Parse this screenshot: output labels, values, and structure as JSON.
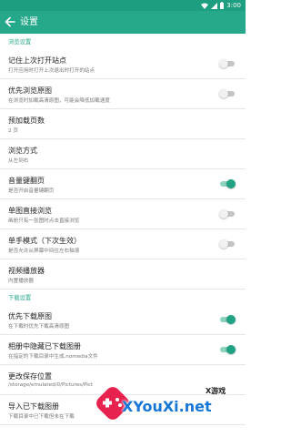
{
  "status_bar": {
    "time": "3:00",
    "icons": [
      "wifi-icon",
      "cellular-icon",
      "battery-icon"
    ]
  },
  "app_bar": {
    "title": "设置",
    "back_icon": "arrow-left-icon"
  },
  "theme": {
    "accent": "#26a88a",
    "status_bar": "#1e9e80",
    "switch_on": "#1fa383",
    "switch_off": "#c4c4c4"
  },
  "sections": [
    {
      "header": "浏览设置",
      "prefs": [
        {
          "title": "记住上次打开站点",
          "summary": "打开应用时打开上次退出时打开的站点",
          "toggle": false
        },
        {
          "title": "优先浏览原图",
          "summary": "在浏览时加载高清原图，可能会降低加载速度",
          "toggle": false
        },
        {
          "title": "预加载页数",
          "summary": "2 页",
          "toggle": null
        },
        {
          "title": "浏览方式",
          "summary": "从左到右",
          "toggle": null
        },
        {
          "title": "音量键翻页",
          "summary": "是否开启音量键翻页",
          "toggle": true
        },
        {
          "title": "单图直接浏览",
          "summary": "画册只有一张图时点击直接浏览",
          "toggle": false
        },
        {
          "title": "单手模式（下次生效）",
          "summary": "是否允许从屏幕中间往左右轴滚",
          "toggle": false
        },
        {
          "title": "视频播放器",
          "summary": "内置播放器",
          "toggle": null
        }
      ]
    },
    {
      "header": "下载设置",
      "prefs": [
        {
          "title": "优先下载原图",
          "summary": "在下载时优先下载高清原图",
          "toggle": true
        },
        {
          "title": "相册中隐藏已下载图册",
          "summary": "在指定的下载目录中生成.nomedia文件",
          "toggle": true
        },
        {
          "title": "更改保存位置",
          "summary": "/storage/emulated/0/Pictures/Pict",
          "toggle": null
        },
        {
          "title": "导入已下载图册",
          "summary": "下载目录中已下载但未在下载",
          "toggle": null
        }
      ]
    }
  ],
  "watermark": {
    "brand": "XYouXi.net",
    "sub": "X游戏",
    "logo_icon": "gamepad-logo-icon"
  }
}
